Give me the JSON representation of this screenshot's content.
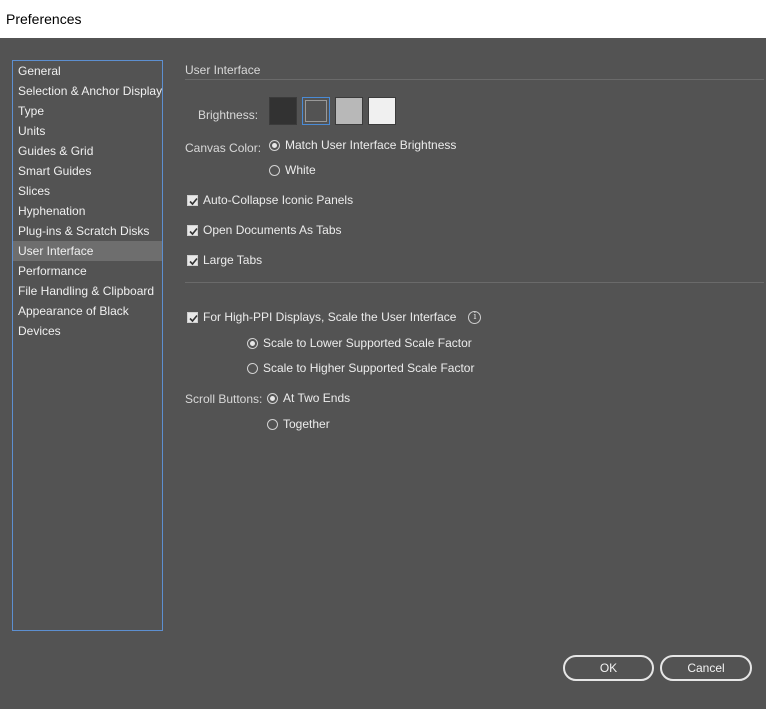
{
  "window": {
    "title": "Preferences"
  },
  "sidebar": {
    "items": [
      {
        "label": "General",
        "selected": false
      },
      {
        "label": "Selection & Anchor Display",
        "selected": false
      },
      {
        "label": "Type",
        "selected": false
      },
      {
        "label": "Units",
        "selected": false
      },
      {
        "label": "Guides & Grid",
        "selected": false
      },
      {
        "label": "Smart Guides",
        "selected": false
      },
      {
        "label": "Slices",
        "selected": false
      },
      {
        "label": "Hyphenation",
        "selected": false
      },
      {
        "label": "Plug-ins & Scratch Disks",
        "selected": false
      },
      {
        "label": "User Interface",
        "selected": true
      },
      {
        "label": "Performance",
        "selected": false
      },
      {
        "label": "File Handling & Clipboard",
        "selected": false
      },
      {
        "label": "Appearance of Black",
        "selected": false
      },
      {
        "label": "Devices",
        "selected": false
      }
    ]
  },
  "panel": {
    "section_title": "User Interface",
    "brightness": {
      "label": "Brightness:",
      "swatches": [
        {
          "color": "#323232",
          "selected": false
        },
        {
          "color": "#535353",
          "selected": true
        },
        {
          "color": "#b8b8b8",
          "selected": false
        },
        {
          "color": "#f0f0f0",
          "selected": false
        }
      ]
    },
    "canvas_color": {
      "label": "Canvas Color:",
      "options": [
        {
          "label": "Match User Interface Brightness",
          "checked": true
        },
        {
          "label": "White",
          "checked": false
        }
      ]
    },
    "checkboxes": [
      {
        "label": "Auto-Collapse Iconic Panels",
        "checked": true
      },
      {
        "label": "Open Documents As Tabs",
        "checked": true
      },
      {
        "label": "Large Tabs",
        "checked": true
      }
    ],
    "high_ppi": {
      "label": "For High-PPI Displays, Scale the User Interface",
      "checked": true,
      "info_icon": "info-icon",
      "options": [
        {
          "label": "Scale to Lower Supported Scale Factor",
          "checked": true
        },
        {
          "label": "Scale to Higher Supported Scale Factor",
          "checked": false
        }
      ]
    },
    "scroll_buttons": {
      "label": "Scroll Buttons:",
      "options": [
        {
          "label": "At Two Ends",
          "checked": true
        },
        {
          "label": "Together",
          "checked": false
        }
      ]
    }
  },
  "buttons": {
    "ok": "OK",
    "cancel": "Cancel"
  },
  "colors": {
    "background": "#535353",
    "accent": "#4a8bd6",
    "selected_item": "#6e6e6e"
  }
}
